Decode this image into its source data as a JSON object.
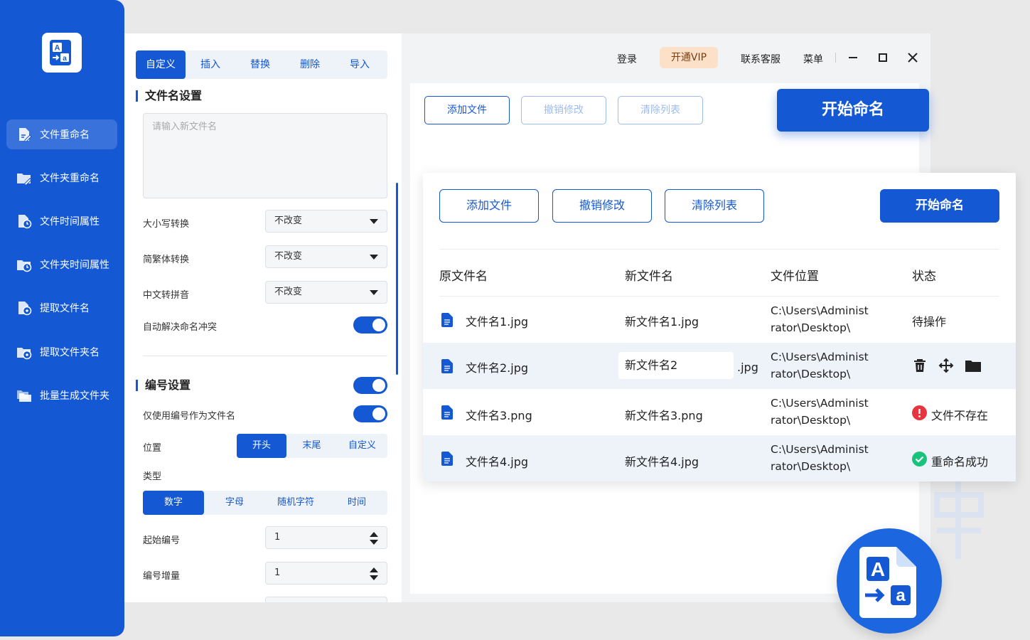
{
  "sidebar": {
    "items": [
      {
        "label": "文件重命名",
        "icon": "file-edit-icon",
        "active": true
      },
      {
        "label": "文件夹重命名",
        "icon": "folder-edit-icon"
      },
      {
        "label": "文件时间属性",
        "icon": "file-clock-icon"
      },
      {
        "label": "文件夹时间属性",
        "icon": "folder-clock-icon"
      },
      {
        "label": "提取文件名",
        "icon": "file-extract-icon"
      },
      {
        "label": "提取文件夹名",
        "icon": "folder-extract-icon"
      },
      {
        "label": "批量生成文件夹",
        "icon": "folders-icon"
      }
    ]
  },
  "tabs": [
    "自定义",
    "插入",
    "替换",
    "删除",
    "导入"
  ],
  "filename_settings": {
    "title": "文件名设置",
    "placeholder": "请输入新文件名",
    "case_label": "大小写转换",
    "case_value": "不改变",
    "trad_label": "简繁体转换",
    "trad_value": "不改变",
    "pinyin_label": "中文转拼音",
    "pinyin_value": "不改变",
    "conflict_label": "自动解决命名冲突"
  },
  "numbering": {
    "title": "编号设置",
    "only_number_label": "仅使用编号作为文件名",
    "position_label": "位置",
    "position_options": [
      "开头",
      "末尾",
      "自定义"
    ],
    "type_label": "类型",
    "type_options": [
      "数字",
      "字母",
      "随机字符",
      "时间"
    ],
    "start_label": "起始编号",
    "start_value": "1",
    "step_label": "编号增量",
    "step_value": "1"
  },
  "titlebar": {
    "login": "登录",
    "vip": "开通VIP",
    "support": "联系客服",
    "menu": "菜单"
  },
  "bg_toolbar": {
    "add": "添加文件",
    "undo": "撤销修改",
    "clear": "清除列表",
    "start": "开始命名"
  },
  "overlay": {
    "add": "添加文件",
    "undo": "撤销修改",
    "clear": "清除列表",
    "start": "开始命名",
    "headers": [
      "原文件名",
      "新文件名",
      "文件位置",
      "状态"
    ],
    "rows": [
      {
        "orig": "文件名1.jpg",
        "new": "新文件名1.jpg",
        "loc1": "C:\\Users\\Administ",
        "loc2": "rator\\Desktop\\",
        "status": "待操作"
      },
      {
        "orig": "文件名2.jpg",
        "new": "新文件名2",
        "ext": ".jpg",
        "loc1": "C:\\Users\\Administ",
        "loc2": "rator\\Desktop\\",
        "status": ""
      },
      {
        "orig": "文件名3.png",
        "new": "新文件名3.png",
        "loc1": "C:\\Users\\Administ",
        "loc2": "rator\\Desktop\\",
        "status": "文件不存在"
      },
      {
        "orig": "文件名4.jpg",
        "new": "新文件名4.jpg",
        "loc1": "C:\\Users\\Administ",
        "loc2": "rator\\Desktop\\",
        "status": "重命名成功"
      }
    ]
  },
  "colors": {
    "primary": "#1458d4",
    "vip_bg": "#fde0c8",
    "error": "#e8343f",
    "success": "#19c37d"
  }
}
